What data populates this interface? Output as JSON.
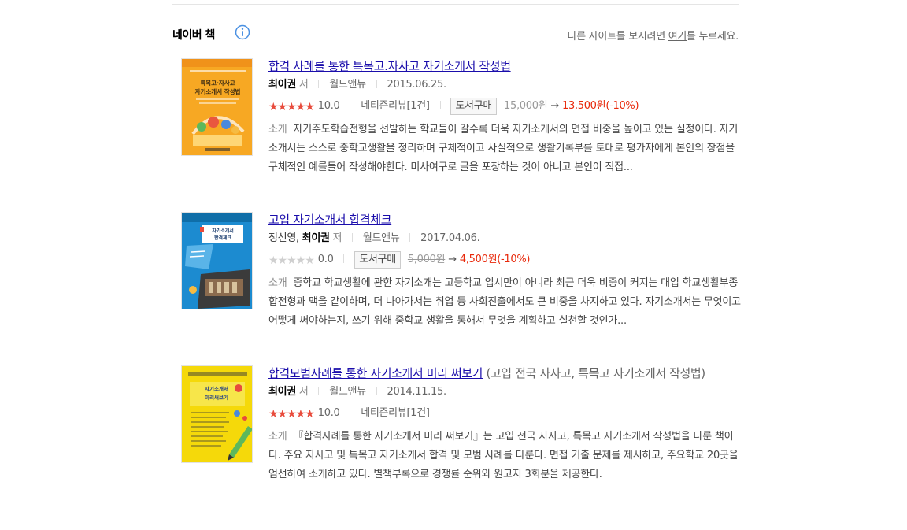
{
  "header": {
    "title": "네이버 책",
    "other_site_prefix": "다른 사이트를 보시려면 ",
    "other_site_link": "여기",
    "other_site_suffix": "를 누르세요."
  },
  "colors": {
    "link": "#1a0dab",
    "star_on": "#e84b3c",
    "star_off": "#cfcfcf",
    "sale_price": "#e8290b",
    "info_icon": "#4a90e2"
  },
  "books": [
    {
      "title": "합격 사례를 통한 특목고.자사고 자기소개서 작성법",
      "subtitle": "",
      "coauthor": "",
      "author": "최이권",
      "role": "저",
      "publisher": "월드앤뉴",
      "date": "2015.06.25.",
      "rating_stars": 5,
      "score": "10.0",
      "review": "네티즌리뷰[1건]",
      "buy_label": "도서구매",
      "price_orig": "15,000원",
      "arrow": "→",
      "price_sale": "13,500원(-10%)",
      "desc_label": "소개",
      "description": "자기주도학습전형을 선발하는 학교들이 갈수록 더욱 자기소개서의 면접 비중을 높이고 있는 실정이다. 자기소개서는 스스로 중학교생활을 정리하며 구체적이고 사실적으로 생활기록부를 토대로 평가자에게 본인의 장점을 구체적인 예를들어 작성해야한다. 미사여구로 글을 포장하는 것이 아니고 본인이 직접...",
      "cover_caption": "특목고·자사고 자기소개서 작성법"
    },
    {
      "title": "고입 자기소개서 합격체크",
      "subtitle": "",
      "coauthor": "정선영, ",
      "author": "최이권",
      "role": "저",
      "publisher": "월드앤뉴",
      "date": "2017.04.06.",
      "rating_stars": 0,
      "score": "0.0",
      "review": "",
      "buy_label": "도서구매",
      "price_orig": "5,000원",
      "arrow": "→",
      "price_sale": "4,500원(-10%)",
      "desc_label": "소개",
      "description": "중학교 학교생활에 관한 자기소개는 고등학교 입시만이 아니라 최근 더욱 비중이 커지는 대입 학교생활부종합전형과 맥을 같이하며, 더 나아가서는 취업 등 사회진출에서도 큰 비중을 차지하고 있다. 자기소개서는 무엇이고 어떻게 써야하는지, 쓰기 위해 중학교 생활을 통해서 무엇을 계획하고 실천할 것인가...",
      "cover_caption": "자기소개서 합격체크"
    },
    {
      "title": "합격모범사례를 통한 자기소개서 미리 써보기",
      "subtitle": " (고입 전국 자사고, 특목고 자기소개서 작성법)",
      "coauthor": "",
      "author": "최이권",
      "role": "저",
      "publisher": "월드앤뉴",
      "date": "2014.11.15.",
      "rating_stars": 5,
      "score": "10.0",
      "review": "네티즌리뷰[1건]",
      "buy_label": "",
      "price_orig": "",
      "arrow": "",
      "price_sale": "",
      "desc_label": "소개",
      "description": "『합격사례를 통한 자기소개서 미리 써보기』는 고입 전국 자사고, 특목고 자기소개서 작성법을 다룬 책이다. 주요 자사고 및 특목고 자기소개서 합격 및 모범 사례를 다룬다. 면접 기출 문제를 제시하고, 주요학교 20곳을 엄선하여 소개하고 있다. 별책부록으로 경쟁률 순위와 원고지 3회분을 제공한다.",
      "cover_caption": "자기소개서 미리 써보기"
    }
  ]
}
